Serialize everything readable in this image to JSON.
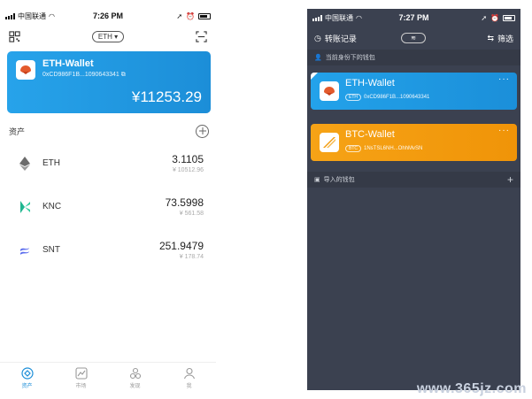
{
  "left_phone": {
    "status": {
      "carrier": "中国联通",
      "time": "7:26 PM"
    },
    "topbar": {
      "network_chip": "ETH"
    },
    "wallet": {
      "name": "ETH-Wallet",
      "address": "0xCD986F1B...1090643341",
      "balance": "¥11253.29"
    },
    "assets_title": "资产",
    "assets": [
      {
        "symbol": "ETH",
        "amount": "3.1105",
        "fiat": "¥ 10512.96",
        "icon": "eth-icon"
      },
      {
        "symbol": "KNC",
        "amount": "73.5998",
        "fiat": "¥ 561.58",
        "icon": "knc-icon"
      },
      {
        "symbol": "SNT",
        "amount": "251.9479",
        "fiat": "¥ 178.74",
        "icon": "snt-icon"
      }
    ],
    "tabs": [
      {
        "label": "资产",
        "icon": "wallet-tab-icon",
        "active": true
      },
      {
        "label": "市场",
        "icon": "market-tab-icon",
        "active": false
      },
      {
        "label": "发现",
        "icon": "discover-tab-icon",
        "active": false
      },
      {
        "label": "我",
        "icon": "profile-tab-icon",
        "active": false
      }
    ]
  },
  "right_phone": {
    "status": {
      "carrier": "中国联通",
      "time": "7:27 PM"
    },
    "topbar": {
      "history_label": "转账记录",
      "filter_label": "筛选",
      "toggle_chip": "≋"
    },
    "current_identity_label": "当前身份下的钱包",
    "wallets": [
      {
        "name": "ETH-Wallet",
        "tag": "ETH",
        "address": "0xCD986F1B...1090643341",
        "theme": "eth"
      },
      {
        "name": "BTC-Wallet",
        "tag": "BTC",
        "address": "1NsTSL6NH...OhhMvSN",
        "theme": "btc"
      }
    ],
    "imported_label": "导入的钱包"
  },
  "watermark": "www.365jz.com",
  "colors": {
    "eth_blue": "#1c8ed8",
    "btc_orange": "#f39b0c",
    "dark_bg": "#3b4150"
  }
}
